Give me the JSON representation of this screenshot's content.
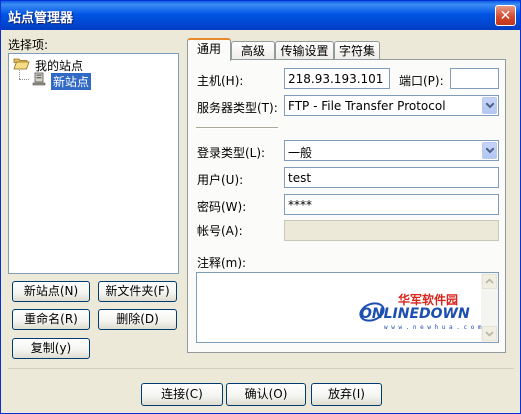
{
  "window": {
    "title": "站点管理器",
    "close_glyph": "✕"
  },
  "left": {
    "select_label": "选择项:",
    "tree": {
      "root": "我的站点",
      "child": "新站点"
    },
    "buttons": {
      "new_site": "新站点(N)",
      "new_folder": "新文件夹(F)",
      "rename": "重命名(R)",
      "delete": "删除(D)",
      "copy": "复制(y)"
    }
  },
  "tabs": [
    "通用",
    "高级",
    "传输设置",
    "字符集"
  ],
  "general": {
    "host_label": "主机(H):",
    "host_value": "218.93.193.101",
    "port_label": "端口(P):",
    "port_value": "",
    "server_type_label": "服务器类型(T):",
    "server_type_value": "FTP - File Transfer Protocol",
    "login_type_label": "登录类型(L):",
    "login_type_value": "一般",
    "user_label": "用户(U):",
    "user_value": "test",
    "password_label": "密码(W):",
    "password_value": "****",
    "account_label": "帐号(A):",
    "account_value": "",
    "comment_label": "注释(m):"
  },
  "watermark": {
    "cn": "华军软件园",
    "en": "ONLINEDOWN",
    "url": "w w w . n e w h u a . c o m"
  },
  "footer": {
    "connect": "连接(C)",
    "ok": "确认(O)",
    "cancel": "放弃(I)"
  },
  "colors": {
    "title_bar": "#0054e3",
    "selection": "#316ac5",
    "tab_active_border": "#e68b2c",
    "watermark_red": "#d8261c",
    "watermark_blue": "#1d4fb0"
  }
}
